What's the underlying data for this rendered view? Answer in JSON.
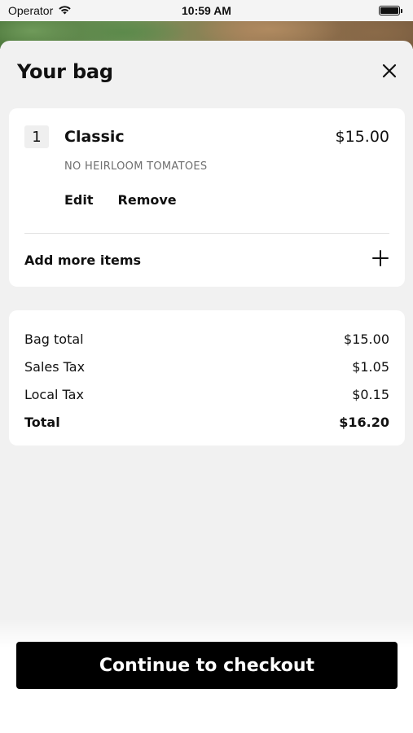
{
  "status_bar": {
    "carrier": "Operator",
    "time": "10:59 AM"
  },
  "sheet": {
    "title": "Your bag"
  },
  "bag_item": {
    "quantity": "1",
    "name": "Classic",
    "price": "$15.00",
    "modifier": "NO HEIRLOOM TOMATOES",
    "edit_label": "Edit",
    "remove_label": "Remove"
  },
  "add_more": {
    "label": "Add more items"
  },
  "totals": {
    "rows": [
      {
        "label": "Bag total",
        "value": "$15.00"
      },
      {
        "label": "Sales Tax",
        "value": "$1.05"
      },
      {
        "label": "Local Tax",
        "value": "$0.15"
      },
      {
        "label": "Total",
        "value": "$16.20"
      }
    ]
  },
  "checkout": {
    "label": "Continue to checkout"
  },
  "icons": {
    "wifi": "wifi-icon",
    "battery": "battery-icon",
    "close": "close-icon",
    "plus": "plus-icon"
  }
}
